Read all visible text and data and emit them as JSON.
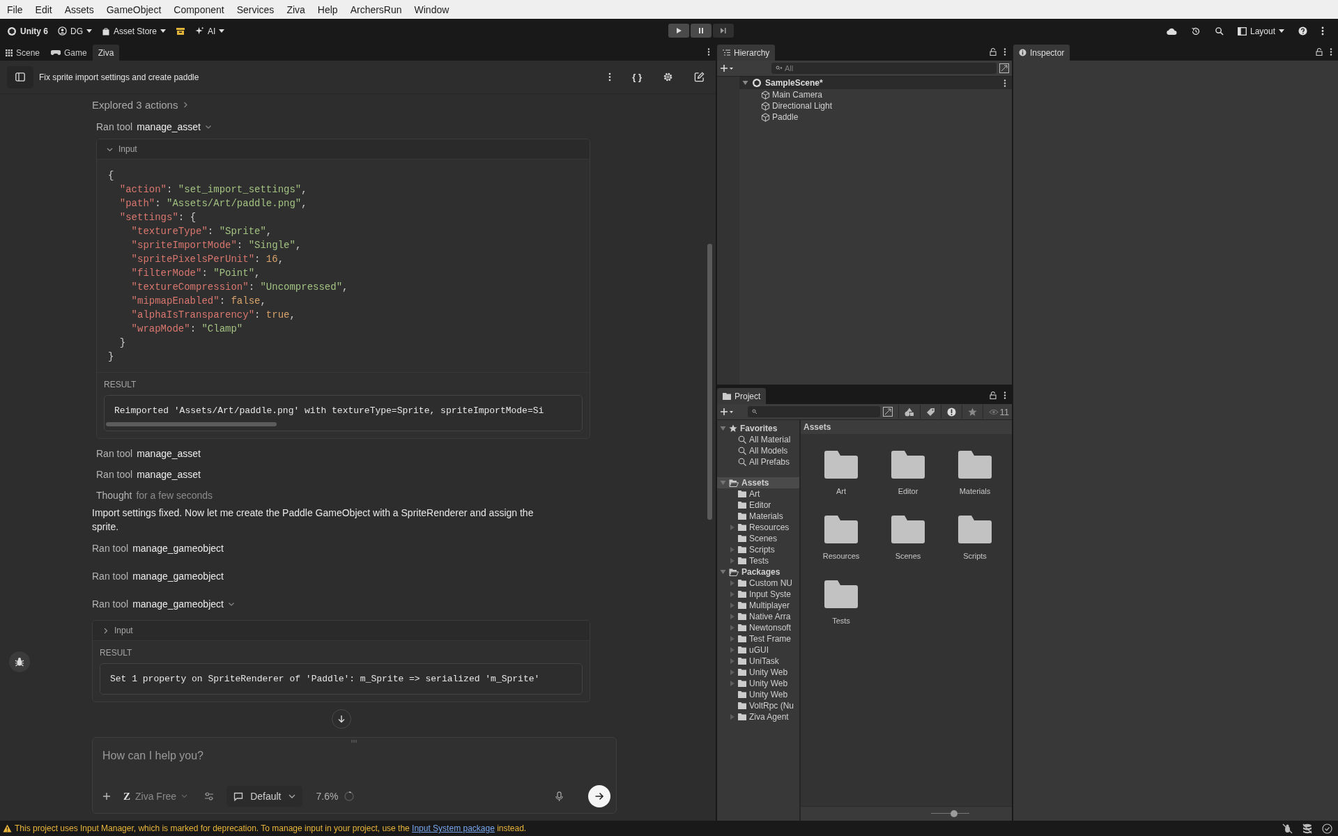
{
  "menu_bar": [
    "File",
    "Edit",
    "Assets",
    "GameObject",
    "Component",
    "Services",
    "Ziva",
    "Help",
    "ArchersRun",
    "Window"
  ],
  "toolbar": {
    "product": "Unity 6",
    "account": "DG",
    "asset_store": "Asset Store",
    "ai": "AI",
    "layout": "Layout"
  },
  "left_tabs": [
    {
      "label": "Scene",
      "selected": false
    },
    {
      "label": "Game",
      "selected": false
    },
    {
      "label": "Ziva",
      "selected": true
    }
  ],
  "chat": {
    "title": "Fix sprite import settings and create paddle",
    "json_icon": "{ }",
    "items": [
      {
        "kind": "summary",
        "text": "Explored 3 actions"
      },
      {
        "kind": "tool",
        "label": "Ran tool",
        "name": "manage_asset",
        "expanded": true,
        "input_label": "Input",
        "input_expanded": true,
        "code": [
          [
            {
              "kind": "punct",
              "text": "{"
            }
          ],
          [
            {
              "kind": "key",
              "text": "  \"action\""
            },
            {
              "kind": "punct",
              "text": ": "
            },
            {
              "kind": "string",
              "text": "\"set_import_settings\""
            },
            {
              "kind": "punct",
              "text": ","
            }
          ],
          [
            {
              "kind": "key",
              "text": "  \"path\""
            },
            {
              "kind": "punct",
              "text": ": "
            },
            {
              "kind": "string",
              "text": "\"Assets/Art/paddle.png\""
            },
            {
              "kind": "punct",
              "text": ","
            }
          ],
          [
            {
              "kind": "key",
              "text": "  \"settings\""
            },
            {
              "kind": "punct",
              "text": ": {"
            }
          ],
          [
            {
              "kind": "key",
              "text": "    \"textureType\""
            },
            {
              "kind": "punct",
              "text": ": "
            },
            {
              "kind": "string",
              "text": "\"Sprite\""
            },
            {
              "kind": "punct",
              "text": ","
            }
          ],
          [
            {
              "kind": "key",
              "text": "    \"spriteImportMode\""
            },
            {
              "kind": "punct",
              "text": ": "
            },
            {
              "kind": "string",
              "text": "\"Single\""
            },
            {
              "kind": "punct",
              "text": ","
            }
          ],
          [
            {
              "kind": "key",
              "text": "    \"spritePixelsPerUnit\""
            },
            {
              "kind": "punct",
              "text": ": "
            },
            {
              "kind": "number",
              "text": "16"
            },
            {
              "kind": "punct",
              "text": ","
            }
          ],
          [
            {
              "kind": "key",
              "text": "    \"filterMode\""
            },
            {
              "kind": "punct",
              "text": ": "
            },
            {
              "kind": "string",
              "text": "\"Point\""
            },
            {
              "kind": "punct",
              "text": ","
            }
          ],
          [
            {
              "kind": "key",
              "text": "    \"textureCompression\""
            },
            {
              "kind": "punct",
              "text": ": "
            },
            {
              "kind": "string",
              "text": "\"Uncompressed\""
            },
            {
              "kind": "punct",
              "text": ","
            }
          ],
          [
            {
              "kind": "key",
              "text": "    \"mipmapEnabled\""
            },
            {
              "kind": "punct",
              "text": ": "
            },
            {
              "kind": "number",
              "text": "false"
            },
            {
              "kind": "punct",
              "text": ","
            }
          ],
          [
            {
              "kind": "key",
              "text": "    \"alphaIsTransparency\""
            },
            {
              "kind": "punct",
              "text": ": "
            },
            {
              "kind": "number",
              "text": "true"
            },
            {
              "kind": "punct",
              "text": ","
            }
          ],
          [
            {
              "kind": "key",
              "text": "    \"wrapMode\""
            },
            {
              "kind": "punct",
              "text": ": "
            },
            {
              "kind": "string",
              "text": "\"Clamp\""
            }
          ],
          [
            {
              "kind": "punct",
              "text": "  }"
            }
          ],
          [
            {
              "kind": "punct",
              "text": "}"
            }
          ]
        ],
        "result_label": "RESULT",
        "result": "Reimported 'Assets/Art/paddle.png' with textureType=Sprite, spriteImportMode=Si",
        "result_scrollbar": true
      },
      {
        "kind": "tool",
        "label": "Ran tool",
        "name": "manage_asset",
        "expanded": false
      },
      {
        "kind": "tool",
        "label": "Ran tool",
        "name": "manage_asset",
        "expanded": false
      },
      {
        "kind": "thought",
        "label": "Thought",
        "detail": "for a few seconds"
      },
      {
        "kind": "message",
        "text": "Import settings fixed. Now let me create the Paddle GameObject with a SpriteRenderer and assign the sprite."
      },
      {
        "kind": "tool",
        "label": "Ran tool",
        "name": "manage_gameobject",
        "expanded": false
      },
      {
        "kind": "tool",
        "label": "Ran tool",
        "name": "manage_gameobject",
        "expanded": false
      },
      {
        "kind": "tool",
        "label": "Ran tool",
        "name": "manage_gameobject",
        "expanded": true,
        "input_label": "Input",
        "input_expanded": false,
        "result_label": "RESULT",
        "result": "Set 1 property on SpriteRenderer of 'Paddle': m_Sprite => serialized 'm_Sprite'",
        "result_scrollbar": false
      }
    ]
  },
  "composer": {
    "placeholder": "How can I help you?",
    "logo": "Z",
    "model": "Ziva Free",
    "mode": "Default",
    "context": "7.6%"
  },
  "hierarchy": {
    "tab": "Hierarchy",
    "search_placeholder": "All",
    "scene": {
      "name": "SampleScene*",
      "expanded": true,
      "children": [
        {
          "name": "Main Camera"
        },
        {
          "name": "Directional Light"
        },
        {
          "name": "Paddle"
        }
      ]
    }
  },
  "inspector": {
    "tab": "Inspector"
  },
  "project": {
    "tab": "Project",
    "hidden_count": "11",
    "tree": [
      {
        "name": "Favorites",
        "kind": "favorites",
        "expanded": true,
        "selected": false,
        "children": [
          {
            "name": "All Material",
            "kind": "search",
            "expandable": false
          },
          {
            "name": "All Models",
            "kind": "search",
            "expandable": false
          },
          {
            "name": "All Prefabs",
            "kind": "search",
            "expandable": false
          }
        ]
      },
      {
        "name": "Assets",
        "kind": "folder",
        "expanded": true,
        "selected": true,
        "children": [
          {
            "name": "Art",
            "kind": "folder",
            "expandable": false
          },
          {
            "name": "Editor",
            "kind": "folder",
            "expandable": false
          },
          {
            "name": "Materials",
            "kind": "folder",
            "expandable": false
          },
          {
            "name": "Resources",
            "kind": "folder",
            "expandable": true
          },
          {
            "name": "Scenes",
            "kind": "folder",
            "expandable": false
          },
          {
            "name": "Scripts",
            "kind": "folder",
            "expandable": true
          },
          {
            "name": "Tests",
            "kind": "folder",
            "expandable": true
          }
        ]
      },
      {
        "name": "Packages",
        "kind": "folder",
        "expanded": true,
        "selected": false,
        "children": [
          {
            "name": "Custom NU",
            "kind": "folder",
            "expandable": true
          },
          {
            "name": "Input Syste",
            "kind": "folder",
            "expandable": true
          },
          {
            "name": "Multiplayer",
            "kind": "folder",
            "expandable": true
          },
          {
            "name": "Native Arra",
            "kind": "folder",
            "expandable": true
          },
          {
            "name": "Newtonsoft",
            "kind": "folder",
            "expandable": true
          },
          {
            "name": "Test Frame",
            "kind": "folder",
            "expandable": true
          },
          {
            "name": "uGUI",
            "kind": "folder",
            "expandable": true
          },
          {
            "name": "UniTask",
            "kind": "folder",
            "expandable": true
          },
          {
            "name": "Unity Web",
            "kind": "folder",
            "expandable": true
          },
          {
            "name": "Unity Web",
            "kind": "folder",
            "expandable": true
          },
          {
            "name": "Unity Web",
            "kind": "folder",
            "expandable": false
          },
          {
            "name": "VoltRpc (Nu",
            "kind": "folder",
            "expandable": false
          },
          {
            "name": "Ziva Agent",
            "kind": "folder",
            "expandable": true
          }
        ]
      }
    ],
    "breadcrumb": "Assets",
    "grid": [
      {
        "name": "Art"
      },
      {
        "name": "Editor"
      },
      {
        "name": "Materials"
      },
      {
        "name": "Resources"
      },
      {
        "name": "Scenes"
      },
      {
        "name": "Scripts"
      },
      {
        "name": "Tests"
      }
    ],
    "icon_size": {
      "level": 0.6
    }
  },
  "status_bar": {
    "before": "This project uses Input Manager, which is marked for deprecation. To manage input in your project, use the ",
    "link": "Input System package",
    "after": " instead."
  }
}
